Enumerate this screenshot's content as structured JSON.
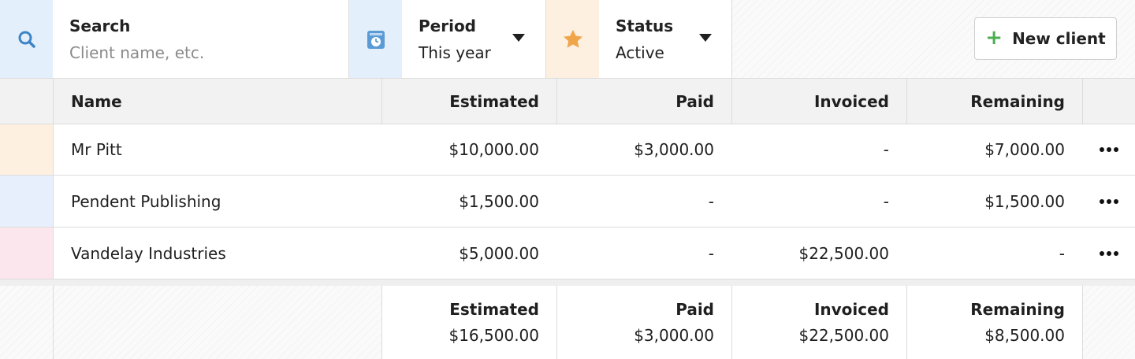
{
  "toolbar": {
    "search": {
      "label": "Search",
      "placeholder": "Client name, etc.",
      "icon": "search-icon",
      "icon_bg": "#e3f0fb",
      "icon_color": "#3d84c6"
    },
    "period": {
      "label": "Period",
      "value": "This year",
      "icon": "calendar-clock-icon",
      "icon_bg": "#e3f0fb",
      "icon_color": "#5b9bd5"
    },
    "status": {
      "label": "Status",
      "value": "Active",
      "icon": "star-icon",
      "icon_bg": "#fdf0e1",
      "icon_color": "#f0a54a"
    },
    "new_client_label": "New client",
    "new_client_icon": "plus-icon"
  },
  "table": {
    "headers": {
      "name": "Name",
      "estimated": "Estimated",
      "paid": "Paid",
      "invoiced": "Invoiced",
      "remaining": "Remaining"
    },
    "rows": [
      {
        "name": "Mr Pitt",
        "estimated": "$10,000.00",
        "paid": "$3,000.00",
        "invoiced": "-",
        "remaining": "$7,000.00",
        "color": "#fdf0e1"
      },
      {
        "name": "Pendent Publishing",
        "estimated": "$1,500.00",
        "paid": "-",
        "invoiced": "-",
        "remaining": "$1,500.00",
        "color": "#e8effc"
      },
      {
        "name": "Vandelay Industries",
        "estimated": "$5,000.00",
        "paid": "-",
        "invoiced": "$22,500.00",
        "remaining": "-",
        "color": "#fce6ee"
      }
    ],
    "row_menu_icon": "more-horizontal-icon",
    "totals": {
      "estimated_label": "Estimated",
      "estimated": "$16,500.00",
      "paid_label": "Paid",
      "paid": "$3,000.00",
      "invoiced_label": "Invoiced",
      "invoiced": "$22,500.00",
      "remaining_label": "Remaining",
      "remaining": "$8,500.00"
    }
  },
  "colors": {
    "border": "#dcdcdc",
    "header_bg": "#f2f2f2",
    "accent_plus": "#4caf50"
  }
}
